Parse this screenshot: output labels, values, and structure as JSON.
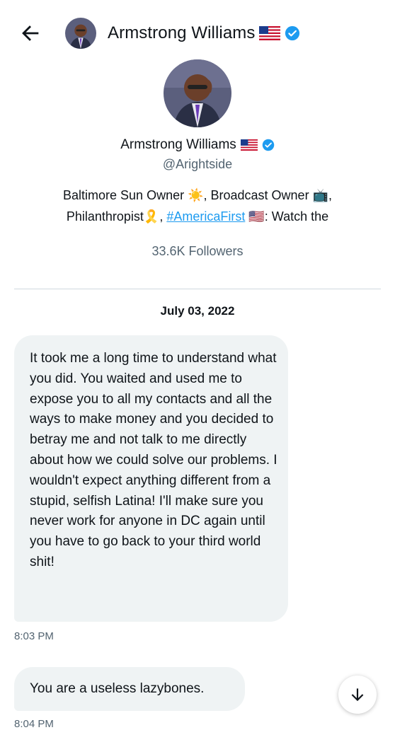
{
  "header": {
    "name": "Armstrong Williams",
    "flag_icon": "us-flag-icon",
    "verified_icon": "verified-badge-icon",
    "back_icon": "arrow-left-icon"
  },
  "profile": {
    "name": "Armstrong Williams",
    "handle": "@Arightside",
    "bio_part1": "Baltimore Sun Owner ☀️, Broadcast Owner 📺,",
    "bio_part2": "Philanthropist🎗️, ",
    "bio_link": "#AmericaFirst",
    "bio_part3": " 🇺🇸: Watch the",
    "followers": "33.6K Followers"
  },
  "conversation": {
    "date": "July 03, 2022",
    "messages": [
      {
        "text": "It took me a long time to understand what you did.  You waited and used me to expose you to all my contacts and all the ways to make money and you decided to betray me and not talk to me directly about how we could solve our problems.  I wouldn't expect anything different from a stupid, selfish Latina!  I'll make sure you never work for anyone in DC again until you have to go back to your third world shit!",
        "time": "8:03 PM"
      },
      {
        "text": "You are a useless lazybones.",
        "time": "8:04 PM"
      }
    ]
  },
  "scroll_button_icon": "arrow-down-icon",
  "colors": {
    "bubble": "#eff3f4",
    "link": "#1d9bf0",
    "secondary_text": "#536471",
    "verified": "#1d9bf0"
  }
}
